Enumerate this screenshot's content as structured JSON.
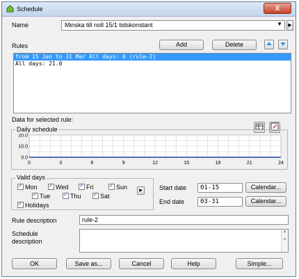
{
  "window": {
    "title": "Schedule",
    "close_label": "X"
  },
  "name": {
    "label": "Name",
    "value": "Minska till noll 15/1 tidskonstant"
  },
  "rules": {
    "label": "Rules",
    "add_label": "Add",
    "delete_label": "Delete",
    "items": [
      "from 15 Jan to 31 Mar All days: 0 (rule-2)",
      "All days: 21.0"
    ]
  },
  "selected_rule": {
    "label": "Data for selected rule:",
    "daily_schedule_label": "Daily schedule"
  },
  "chart_data": {
    "type": "line",
    "title": "Daily schedule",
    "x_ticks": [
      "0",
      "3",
      "6",
      "9",
      "12",
      "15",
      "18",
      "21",
      "24"
    ],
    "y_ticks": [
      "20.0",
      "10.0",
      "0.0"
    ],
    "xlim": [
      0,
      24
    ],
    "ylim": [
      0,
      20
    ],
    "grid": true,
    "series": [
      {
        "x": [
          0,
          24
        ],
        "y": [
          0,
          0
        ],
        "color": "#1f3fa8"
      }
    ]
  },
  "valid_days": {
    "label": "Valid days",
    "days": [
      "Mon",
      "Wed",
      "Fri",
      "Sun",
      "Tue",
      "Thu",
      "Sat",
      "Holidays"
    ]
  },
  "dates": {
    "start_label": "Start date",
    "start_value": "01-15",
    "end_label": "End date",
    "end_value": "03-31",
    "calendar_label": "Calendar..."
  },
  "rule_description": {
    "label": "Rule description",
    "value": "rule-2"
  },
  "schedule_description": {
    "label_line1": "Schedule",
    "label_line2": "description",
    "value": ""
  },
  "buttons": {
    "ok": "OK",
    "save_as": "Save as...",
    "cancel": "Cancel",
    "help": "Help",
    "simple": "Simple..."
  }
}
